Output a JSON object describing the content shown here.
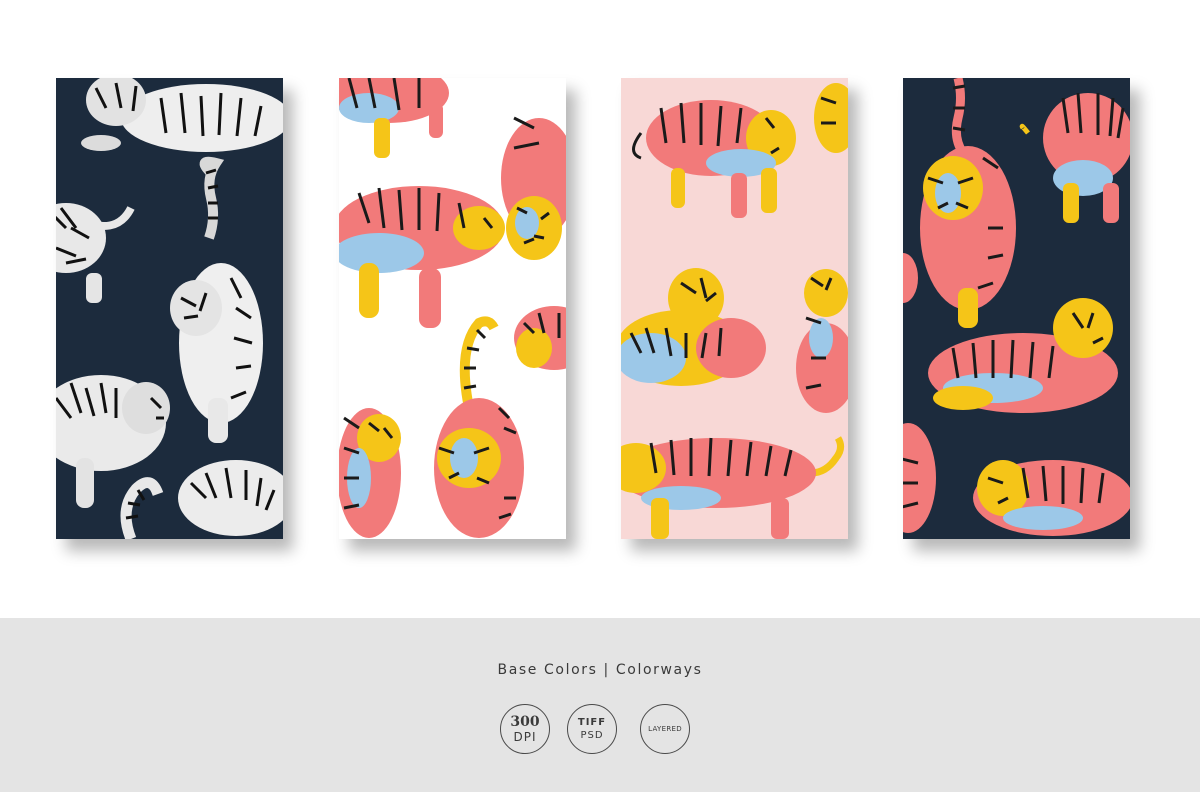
{
  "cards": [
    {
      "name": "navy-white-tigers",
      "background": "#1c2b3d"
    },
    {
      "name": "white-rainbow-tigers",
      "background": "#ffffff"
    },
    {
      "name": "pink-rainbow-tigers",
      "background": "#f8d8d6"
    },
    {
      "name": "navy-rainbow-tigers",
      "background": "#1c2b3d"
    }
  ],
  "footer": {
    "tagline": "Base Colors | Colorways",
    "badges": [
      {
        "line1": "300",
        "line2": "DPI"
      },
      {
        "line1": "TIFF",
        "line2": "PSD"
      },
      {
        "line1": "LAYERED"
      }
    ]
  },
  "colors": {
    "footer_bg": "#e4e4e4",
    "navy": "#1c2b3d",
    "pink_bg": "#f8d8d6",
    "tiger_coral": "#f27a7a",
    "tiger_yellow": "#f5c518",
    "tiger_blue": "#9cc8e8"
  }
}
